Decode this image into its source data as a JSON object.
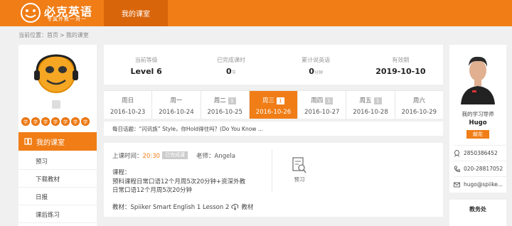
{
  "header": {
    "brand": "必克英语",
    "slogan": "专属外教一对一",
    "nav_active": "我的课室"
  },
  "breadcrumb": {
    "prefix": "当前位置：",
    "home": "首页",
    "separator": ">",
    "current": "我的课室"
  },
  "sidebar": {
    "medals": [
      "学",
      "学",
      "学",
      "学",
      "学",
      "学",
      "学"
    ],
    "active_item": "我的课室",
    "items": [
      "预习",
      "下载教材",
      "日报",
      "课后练习"
    ]
  },
  "stats": [
    {
      "label": "当前等级",
      "value": "Level 6",
      "unit": ""
    },
    {
      "label": "已完成课时",
      "value": "0",
      "unit": "节"
    },
    {
      "label": "累计说英语",
      "value": "0",
      "unit": "分钟"
    },
    {
      "label": "有效期",
      "value": "2019-10-10",
      "unit": ""
    }
  ],
  "week": [
    {
      "name": "周日",
      "date": "2016-10-23",
      "badge": ""
    },
    {
      "name": "周一",
      "date": "2016-10-24",
      "badge": ""
    },
    {
      "name": "周二",
      "date": "2016-10-25",
      "badge": "1"
    },
    {
      "name": "周三",
      "date": "2016-10-26",
      "badge": "1"
    },
    {
      "name": "周四",
      "date": "2016-10-27",
      "badge": "1"
    },
    {
      "name": "周五",
      "date": "2016-10-28",
      "badge": "1"
    },
    {
      "name": "周六",
      "date": "2016-10-29",
      "badge": ""
    }
  ],
  "topic": "每日话题：“闪讯族” Style，你Hold得住吗？(Do You Know ...",
  "lesson": {
    "time_label": "上课时间：",
    "time": "20:30",
    "pill": "已完成课",
    "teacher_label": "老师：",
    "teacher": "Angela",
    "course_label": "课程：",
    "course_line1": "预科课程日常口语12个月周5次20分钟+资深外教",
    "course_line2": "日常口语12个月周5次20分钟",
    "preview_label": "预习",
    "material_prefix": "教材：Spiiker Smart English 1 Lesson 2",
    "material_link": "教材"
  },
  "advisor": {
    "title": "我的学习导师",
    "name": "Hugo",
    "flower": "献花",
    "qq": "2850386452",
    "phone": "020-28817052",
    "email": "hugo@spiike..."
  },
  "office": {
    "title": "教务处"
  },
  "colors": {
    "accent": "#f07d16",
    "accent_dark": "#d9650a"
  }
}
